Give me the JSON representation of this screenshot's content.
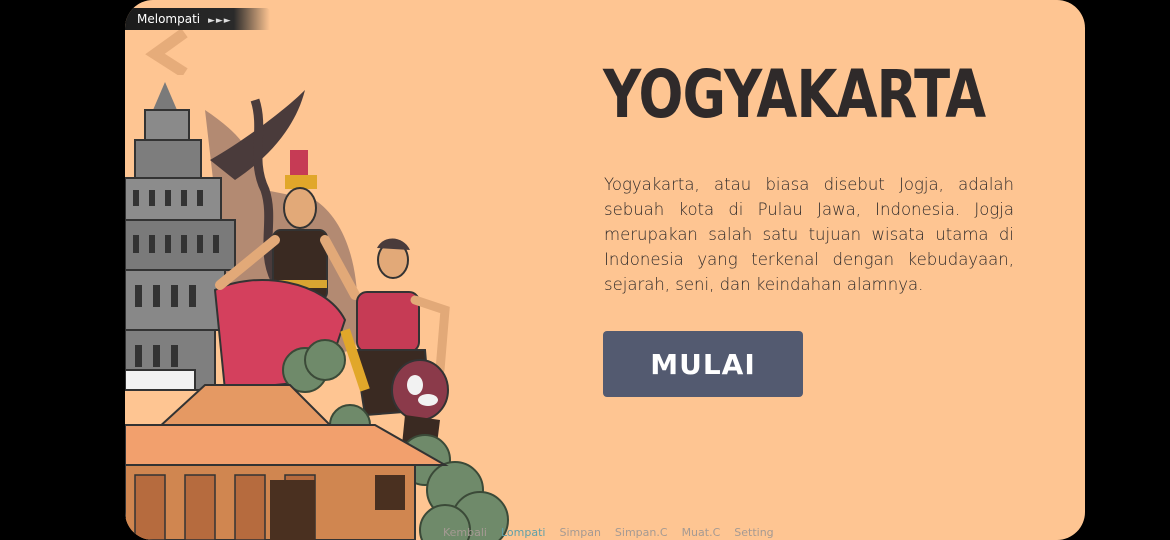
{
  "skip_badge": {
    "label": "Melompati",
    "arrows": "►►►"
  },
  "scene": {
    "title": "YOGYAKARTA",
    "description": "Yogyakarta, atau biasa disebut Jogja, adalah sebuah kota di Pulau Jawa, Indonesia. Jogja merupakan salah satu tujuan wisata utama di Indonesia yang terkenal dengan kebudayaan, sejarah, seni, dan keindahan alamnya.",
    "start_label": "MULAI"
  },
  "quick_menu": {
    "items": [
      "Kembali",
      "Lompati",
      "Simpan",
      "Simpan.C",
      "Muat.C",
      "Setting"
    ]
  },
  "colors": {
    "background": "#fec592",
    "button": "#535a70",
    "title_text": "#2f2a2a",
    "active_menu": "#5fa0a8"
  }
}
